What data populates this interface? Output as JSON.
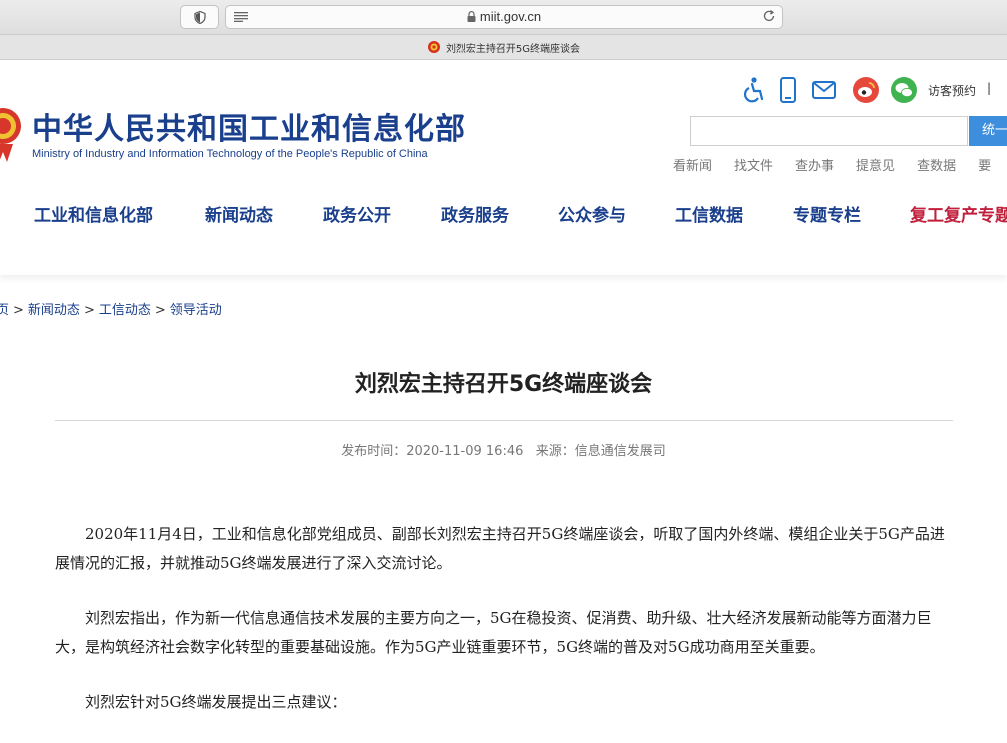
{
  "browser": {
    "url": "miit.gov.cn",
    "tab_title": "刘烈宏主持召开5G终端座谈会"
  },
  "header": {
    "logo_cn": "中华人民共和国工业和信息化部",
    "logo_en": "Ministry of Industry and Information Technology of the People's Republic of China",
    "visitor_link": "访客预约",
    "separator": "|",
    "search_placeholder": "",
    "search_button": "统一",
    "quick_links": [
      "看新闻",
      "找文件",
      "查办事",
      "提意见",
      "查数据",
      "要"
    ],
    "icons": [
      "accessibility-icon",
      "mobile-icon",
      "mail-icon",
      "weibo-icon",
      "wechat-icon"
    ]
  },
  "nav": {
    "items": [
      "工业和信息化部",
      "新闻动态",
      "政务公开",
      "政务服务",
      "公众参与",
      "工信数据",
      "专题专栏",
      "复工复产专题"
    ]
  },
  "breadcrumb": {
    "items": [
      "页",
      "新闻动态",
      "工信动态",
      "领导活动"
    ],
    "separator": ">"
  },
  "article": {
    "title": "刘烈宏主持召开5G终端座谈会",
    "meta": "发布时间：2020-11-09 16:46   来源：信息通信发展司",
    "paragraphs": [
      "2020年11月4日，工业和信息化部党组成员、副部长刘烈宏主持召开5G终端座谈会，听取了国内外终端、模组企业关于5G产品进展情况的汇报，并就推动5G终端发展进行了深入交流讨论。",
      "刘烈宏指出，作为新一代信息通信技术发展的主要方向之一，5G在稳投资、促消费、助升级、壮大经济发展新动能等方面潜力巨大，是构筑经济社会数字化转型的重要基础设施。作为5G产业链重要环节，5G终端的普及对5G成功商用至关重要。",
      "刘烈宏针对5G终端发展提出三点建议："
    ]
  },
  "colors": {
    "brand_blue": "#1a3f8c",
    "accent_red": "#c0203c",
    "search_blue": "#3e8ede"
  }
}
